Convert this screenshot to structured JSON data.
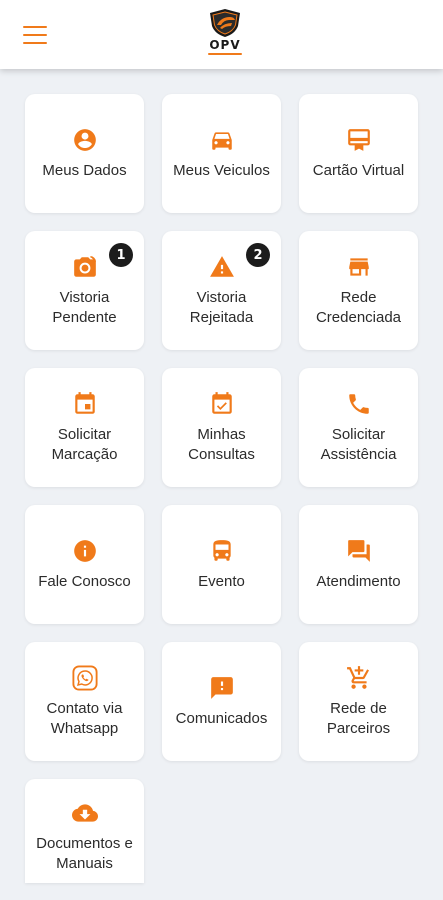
{
  "app": {
    "logo_text": "OPV",
    "accent_color": "#f07a1a",
    "menu_icon": "hamburger-menu-icon"
  },
  "tiles": [
    {
      "label": "Meus Dados",
      "icon": "account-circle-icon"
    },
    {
      "label": "Meus Veiculos",
      "icon": "car-icon"
    },
    {
      "label": "Cartão Virtual",
      "icon": "card-membership-icon"
    },
    {
      "label": "Vistoria\nPendente",
      "icon": "camera-rotate-icon",
      "badge": "1"
    },
    {
      "label": "Vistoria\nRejeitada",
      "icon": "warning-icon",
      "badge": "2"
    },
    {
      "label": "Rede\nCredenciada",
      "icon": "store-icon"
    },
    {
      "label": "Solicitar\nMarcação",
      "icon": "calendar-event-icon"
    },
    {
      "label": "Minhas\nConsultas",
      "icon": "calendar-check-icon"
    },
    {
      "label": "Solicitar\nAssistência",
      "icon": "phone-icon"
    },
    {
      "label": "Fale Conosco",
      "icon": "info-icon"
    },
    {
      "label": "Evento",
      "icon": "bus-icon"
    },
    {
      "label": "Atendimento",
      "icon": "forum-icon"
    },
    {
      "label": "Contato via\nWhatsapp",
      "icon": "whatsapp-icon"
    },
    {
      "label": "Comunicados",
      "icon": "feedback-icon"
    },
    {
      "label": "Rede de\nParceiros",
      "icon": "cart-add-icon"
    },
    {
      "label": "Documentos e\nManuais",
      "icon": "cloud-download-icon"
    }
  ]
}
